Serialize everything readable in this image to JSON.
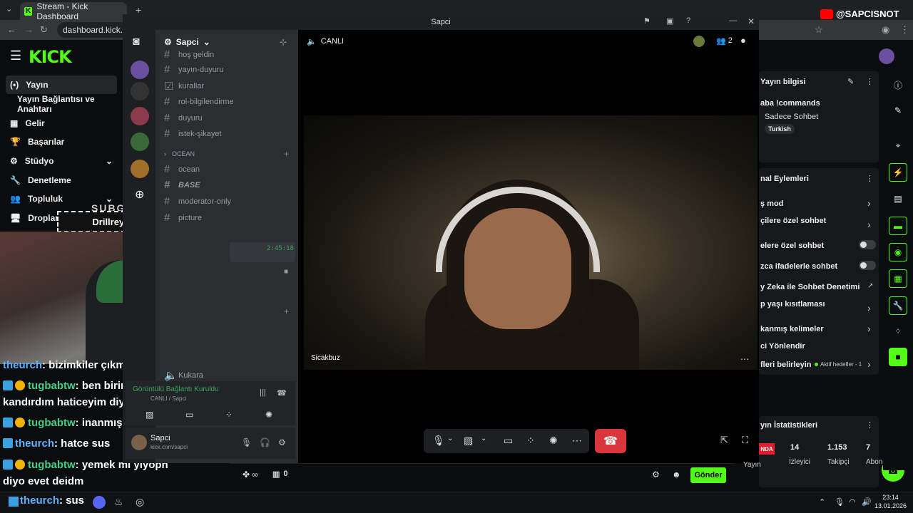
{
  "browser": {
    "tab_title": "Stream - Kick Dashboard",
    "url": "dashboard.kick.c"
  },
  "social_badge": "@SAPCISNOT",
  "kick_nav": {
    "logo": "KICK",
    "items": [
      {
        "label": "Yayın",
        "icon": "(•)"
      },
      {
        "label": "Yayın Bağlantısı ve Anahtarı",
        "icon": ""
      },
      {
        "label": "Gelir",
        "icon": "▦"
      },
      {
        "label": "Başarılar",
        "icon": "🏆"
      },
      {
        "label": "Stüdyo",
        "icon": "⚙"
      },
      {
        "label": "Denetleme",
        "icon": "🔧"
      },
      {
        "label": "Topluluk",
        "icon": "👥"
      },
      {
        "label": "Droplar ve ödüller",
        "icon": "🖥"
      }
    ]
  },
  "webcam": {
    "tag_label": "Drillreynaa",
    "overlay_text": "SUBG"
  },
  "chat": [
    {
      "user": "theurch",
      "text": ": bizimkiler çıkmış",
      "color": "blue",
      "badges": false
    },
    {
      "user": "tugbabtw",
      "text": ": ben birini",
      "color": "green",
      "badges": true
    },
    {
      "user": "",
      "text": "kandırdım haticeyim diye",
      "color": "",
      "badges": false
    },
    {
      "user": "tugbabtw",
      "text": ": inanmış",
      "color": "green",
      "badges": true
    },
    {
      "user": "theurch",
      "text": ": hatce sus",
      "color": "blue",
      "badges": true
    },
    {
      "user": "tugbabtw",
      "text": ": yemek mi yiyopn",
      "color": "green",
      "badges": true
    },
    {
      "user": "",
      "text": "diyo evet deidm",
      "color": "",
      "badges": false
    },
    {
      "user": "theurch",
      "text": ": sus",
      "color": "blue",
      "badges": true
    }
  ],
  "discord": {
    "window_title": "Sapci",
    "server_name": "Sapci",
    "channel_header": "CANLI",
    "participant_count": "2",
    "channels": [
      {
        "icon": "#",
        "label": "hoş geldin"
      },
      {
        "icon": "#",
        "label": "yayın-duyuru"
      },
      {
        "icon": "☑",
        "label": "kurallar"
      },
      {
        "icon": "#",
        "label": "rol-bilgilendirme"
      },
      {
        "icon": "#",
        "label": "duyuru"
      },
      {
        "icon": "#",
        "label": "istek-şikayet"
      }
    ],
    "category": "OCEAN",
    "category_channels": [
      {
        "label": "ocean"
      },
      {
        "label": "BASE"
      },
      {
        "label": "moderator-only"
      },
      {
        "label": "picture"
      }
    ],
    "snippet_time": "2:45:18",
    "voice_channel": "Kukara",
    "voice_status": "Görüntülü Bağlantı Kuruldu",
    "voice_sub": "CANLI  / Sapci",
    "user_name": "Sapci",
    "user_status": "kick.com/sapci",
    "video_label": "Sicakbuz"
  },
  "right_panel": {
    "stream_info_title": "Yayın bilgisi",
    "commands": "aba !commands",
    "chat_mode": "Sadece Sohbet",
    "language": "Turkish",
    "channel_actions_title": "nal Eylemleri",
    "actions": [
      {
        "label": "ş mod",
        "control": "chevron"
      },
      {
        "label": "çilere özel sohbet",
        "control": "chevron"
      },
      {
        "label": "elere özel sohbet",
        "control": "toggle"
      },
      {
        "label": "zca ifadelerle sohbet",
        "control": "toggle"
      },
      {
        "label": "y Zeka ile Sohbet Denetimi",
        "control": "external"
      },
      {
        "label": "p yaşı kısıtlaması",
        "control": "chevron"
      },
      {
        "label": "kanmış kelimeler",
        "control": "chevron"
      },
      {
        "label": "ci Yönlendir",
        "control": "none"
      },
      {
        "label": "fleri belirleyin",
        "control": "chevron"
      }
    ],
    "active_goals": "Aktif hedefler - 1",
    "stats_title": "yın İstatistikleri",
    "stats": [
      {
        "label": "Yayın",
        "value": "NDA"
      },
      {
        "label": "İzleyici",
        "value": "14"
      },
      {
        "label": "Takipçi",
        "value": "1.153"
      },
      {
        "label": "Abone Sayı",
        "value": "7"
      }
    ]
  },
  "chat_input": {
    "infinity": "∞",
    "count": "0",
    "send_label": "Gönder"
  },
  "taskbar": {
    "time": "23:14",
    "date": "13.01.2026"
  },
  "colors": {
    "kick_green": "#53fc18",
    "discord_bg": "#1e1f22",
    "hangup_red": "#da373c"
  }
}
